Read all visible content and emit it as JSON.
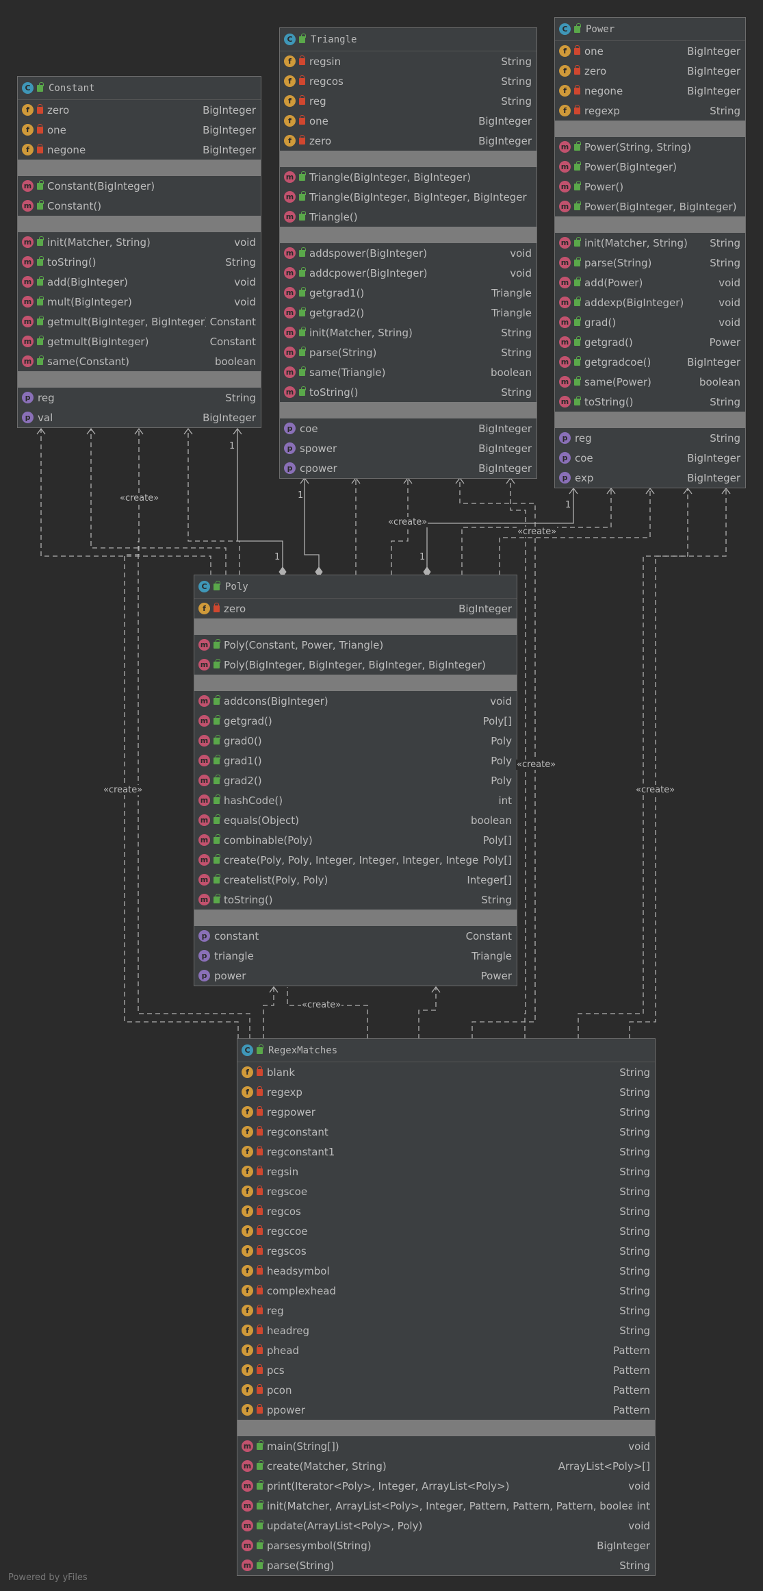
{
  "classes": {
    "constant": {
      "name": "Constant",
      "fields": [
        [
          "zero",
          "BigInteger"
        ],
        [
          "one",
          "BigInteger"
        ],
        [
          "negone",
          "BigInteger"
        ]
      ],
      "constructors": [
        [
          "Constant(BigInteger)",
          ""
        ],
        [
          "Constant()",
          ""
        ]
      ],
      "methods": [
        [
          "init(Matcher, String)",
          "void"
        ],
        [
          "toString()",
          "String"
        ],
        [
          "add(BigInteger)",
          "void"
        ],
        [
          "mult(BigInteger)",
          "void"
        ],
        [
          "getmult(BigInteger, BigInteger)",
          "Constant"
        ],
        [
          "getmult(BigInteger)",
          "Constant"
        ],
        [
          "same(Constant)",
          "boolean"
        ]
      ],
      "properties": [
        [
          "reg",
          "String"
        ],
        [
          "val",
          "BigInteger"
        ]
      ]
    },
    "triangle": {
      "name": "Triangle",
      "fields": [
        [
          "regsin",
          "String"
        ],
        [
          "regcos",
          "String"
        ],
        [
          "reg",
          "String"
        ],
        [
          "one",
          "BigInteger"
        ],
        [
          "zero",
          "BigInteger"
        ]
      ],
      "constructors": [
        [
          "Triangle(BigInteger, BigInteger)",
          ""
        ],
        [
          "Triangle(BigInteger, BigInteger, BigInteger)",
          ""
        ],
        [
          "Triangle()",
          ""
        ]
      ],
      "methods": [
        [
          "addspower(BigInteger)",
          "void"
        ],
        [
          "addcpower(BigInteger)",
          "void"
        ],
        [
          "getgrad1()",
          "Triangle"
        ],
        [
          "getgrad2()",
          "Triangle"
        ],
        [
          "init(Matcher, String)",
          "String"
        ],
        [
          "parse(String)",
          "String"
        ],
        [
          "same(Triangle)",
          "boolean"
        ],
        [
          "toString()",
          "String"
        ]
      ],
      "properties": [
        [
          "coe",
          "BigInteger"
        ],
        [
          "spower",
          "BigInteger"
        ],
        [
          "cpower",
          "BigInteger"
        ]
      ]
    },
    "power": {
      "name": "Power",
      "fields": [
        [
          "one",
          "BigInteger"
        ],
        [
          "zero",
          "BigInteger"
        ],
        [
          "negone",
          "BigInteger"
        ],
        [
          "regexp",
          "String"
        ]
      ],
      "constructors": [
        [
          "Power(String, String)",
          ""
        ],
        [
          "Power(BigInteger)",
          ""
        ],
        [
          "Power()",
          ""
        ],
        [
          "Power(BigInteger, BigInteger)",
          ""
        ]
      ],
      "methods": [
        [
          "init(Matcher, String)",
          "String"
        ],
        [
          "parse(String)",
          "String"
        ],
        [
          "add(Power)",
          "void"
        ],
        [
          "addexp(BigInteger)",
          "void"
        ],
        [
          "grad()",
          "void"
        ],
        [
          "getgrad()",
          "Power"
        ],
        [
          "getgradcoe()",
          "BigInteger"
        ],
        [
          "same(Power)",
          "boolean"
        ],
        [
          "toString()",
          "String"
        ]
      ],
      "properties": [
        [
          "reg",
          "String"
        ],
        [
          "coe",
          "BigInteger"
        ],
        [
          "exp",
          "BigInteger"
        ]
      ]
    },
    "poly": {
      "name": "Poly",
      "fields": [
        [
          "zero",
          "BigInteger"
        ]
      ],
      "constructors": [
        [
          "Poly(Constant, Power, Triangle)",
          ""
        ],
        [
          "Poly(BigInteger, BigInteger, BigInteger, BigInteger)",
          ""
        ]
      ],
      "methods": [
        [
          "addcons(BigInteger)",
          "void"
        ],
        [
          "getgrad()",
          "Poly[]"
        ],
        [
          "grad0()",
          "Poly"
        ],
        [
          "grad1()",
          "Poly"
        ],
        [
          "grad2()",
          "Poly"
        ],
        [
          "hashCode()",
          "int"
        ],
        [
          "equals(Object)",
          "boolean"
        ],
        [
          "combinable(Poly)",
          "Poly[]"
        ],
        [
          "create(Poly, Poly, Integer, Integer, Integer, Integer)",
          "Poly[]"
        ],
        [
          "createlist(Poly, Poly)",
          "Integer[]"
        ],
        [
          "toString()",
          "String"
        ]
      ],
      "properties": [
        [
          "constant",
          "Constant"
        ],
        [
          "triangle",
          "Triangle"
        ],
        [
          "power",
          "Power"
        ]
      ]
    },
    "regex": {
      "name": "RegexMatches",
      "fields": [
        [
          "blank",
          "String"
        ],
        [
          "regexp",
          "String"
        ],
        [
          "regpower",
          "String"
        ],
        [
          "regconstant",
          "String"
        ],
        [
          "regconstant1",
          "String"
        ],
        [
          "regsin",
          "String"
        ],
        [
          "regscoe",
          "String"
        ],
        [
          "regcos",
          "String"
        ],
        [
          "regccoe",
          "String"
        ],
        [
          "regscos",
          "String"
        ],
        [
          "headsymbol",
          "String"
        ],
        [
          "complexhead",
          "String"
        ],
        [
          "reg",
          "String"
        ],
        [
          "headreg",
          "String"
        ],
        [
          "phead",
          "Pattern"
        ],
        [
          "pcs",
          "Pattern"
        ],
        [
          "pcon",
          "Pattern"
        ],
        [
          "ppower",
          "Pattern"
        ]
      ],
      "constructors": [],
      "methods": [
        [
          "main(String[])",
          "void"
        ],
        [
          "create(Matcher, String)",
          "ArrayList<Poly>[]"
        ],
        [
          "print(Iterator<Poly>, Integer, ArrayList<Poly>)",
          "void"
        ],
        [
          "init(Matcher, ArrayList<Poly>, Integer, Pattern, Pattern, Pattern, boolean)",
          "int"
        ],
        [
          "update(ArrayList<Poly>, Poly)",
          "void"
        ],
        [
          "parsesymbol(String)",
          "BigInteger"
        ],
        [
          "parse(String)",
          "String"
        ]
      ],
      "properties": []
    }
  },
  "labels": {
    "create": "«create»",
    "one": "1"
  },
  "footer": "Powered by yFiles"
}
